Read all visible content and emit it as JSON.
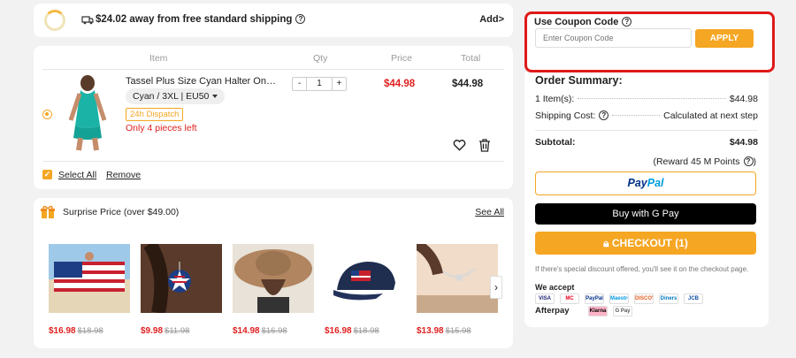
{
  "shipping": {
    "message": "$24.02 away from free standard shipping",
    "add_label": "Add>"
  },
  "cart": {
    "headers": {
      "item": "Item",
      "qty": "Qty",
      "price": "Price",
      "total": "Total"
    },
    "item": {
      "name": "Tassel Plus Size Cyan Halter One Piec...",
      "variant": "Cyan / 3XL | EU50",
      "dispatch": "24h Dispatch",
      "stock": "Only 4 pieces left",
      "qty_minus": "-",
      "qty": "1",
      "qty_plus": "+",
      "price": "$44.98",
      "total": "$44.98"
    },
    "select_all": "Select All",
    "remove": "Remove"
  },
  "surprise": {
    "title": "Surprise Price (over $49.00)",
    "see_all": "See All",
    "items": [
      {
        "price": "$16.98",
        "old_price": "$18.98"
      },
      {
        "price": "$9.98",
        "old_price": "$11.98"
      },
      {
        "price": "$14.98",
        "old_price": "$16.98"
      },
      {
        "price": "$16.98",
        "old_price": "$18.98"
      },
      {
        "price": "$13.98",
        "old_price": "$15.98"
      }
    ],
    "next_arrow": "›"
  },
  "coupon": {
    "title": "Use Coupon Code",
    "placeholder": "Enter Coupon Code",
    "apply": "APPLY"
  },
  "summary": {
    "title": "Order Summary:",
    "items_label": "1 Item(s):",
    "items_value": "$44.98",
    "shipping_label": "Shipping Cost:",
    "shipping_value": "Calculated at next step",
    "subtotal_label": "Subtotal:",
    "subtotal_value": "$44.98",
    "reward": "(Reward 45 M Points",
    "paypal_1": "Pay",
    "paypal_2": "Pal",
    "gpay": "Buy with G Pay",
    "checkout": "CHECKOUT (1)",
    "note": "If there's special discount offered, you'll see it on the checkout page.",
    "we_accept": "We accept",
    "cards": [
      "VISA",
      "MC",
      "PayPal",
      "Maestro",
      "DISCOVER",
      "Diners",
      "JCB",
      "Klarna",
      "G Pay"
    ],
    "afterpay": "Afterpay"
  },
  "colors": {
    "accent": "#f5a623",
    "price_red": "#e02020",
    "highlight_border": "#e01919"
  }
}
